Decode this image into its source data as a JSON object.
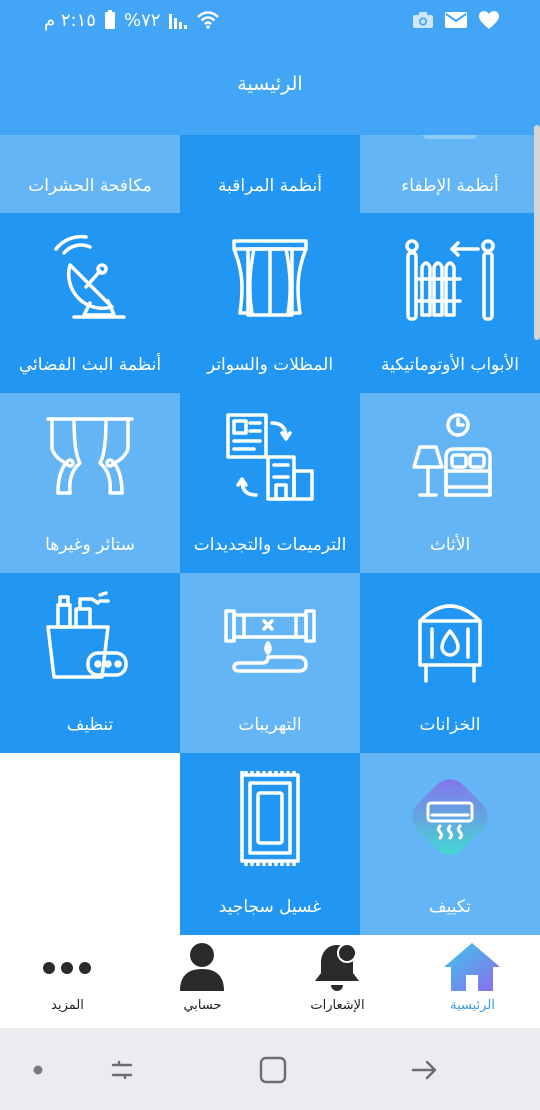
{
  "status_bar": {
    "time": "٢:١٥ م",
    "battery": "٧٢%",
    "icons": [
      "heart-icon",
      "mail-icon",
      "camera-icon",
      "wifi-icon",
      "signal-icon",
      "battery-icon"
    ]
  },
  "app_bar": {
    "title": "الرئيسية"
  },
  "tiles": [
    {
      "label": "أنظمة الإطفاء",
      "icon": "fire-extinguishing-icon",
      "tone": "light"
    },
    {
      "label": "أنظمة المراقبة",
      "icon": "surveillance-icon",
      "tone": "dark"
    },
    {
      "label": "مكافحة الحشرات",
      "icon": "pest-control-icon",
      "tone": "light"
    },
    {
      "label": "الأبواب الأوتوماتيكية",
      "icon": "automatic-gate-icon",
      "tone": "dark"
    },
    {
      "label": "المظلات والسواتر",
      "icon": "window-curtains-icon",
      "tone": "dark"
    },
    {
      "label": "أنظمة البث الفضائي",
      "icon": "satellite-dish-icon",
      "tone": "dark"
    },
    {
      "label": "الأثاث",
      "icon": "furniture-bedroom-icon",
      "tone": "light"
    },
    {
      "label": "الترميمات والتجديدات",
      "icon": "renovation-icon",
      "tone": "dark"
    },
    {
      "label": "ستائر وغيرها",
      "icon": "curtains-icon",
      "tone": "light"
    },
    {
      "label": "الخزانات",
      "icon": "water-tank-icon",
      "tone": "dark"
    },
    {
      "label": "التهريبات",
      "icon": "leaking-pipe-icon",
      "tone": "light"
    },
    {
      "label": "تنظيف",
      "icon": "cleaning-bucket-icon",
      "tone": "dark"
    },
    {
      "label": "تكييف",
      "icon": "air-conditioner-icon",
      "tone": "light"
    },
    {
      "label": "غسيل سجاجيد",
      "icon": "carpet-icon",
      "tone": "dark"
    }
  ],
  "bottom_nav": [
    {
      "label": "الرئيسية",
      "icon": "home-icon",
      "active": true
    },
    {
      "label": "الإشعارات",
      "icon": "bell-icon",
      "active": false
    },
    {
      "label": "حسابي",
      "icon": "user-icon",
      "active": false
    },
    {
      "label": "المزيد",
      "icon": "more-dots-icon",
      "active": false
    }
  ],
  "system_nav": [
    "recent-apps-icon",
    "home-square-icon",
    "back-arrow-icon",
    "dot-indicator-icon"
  ],
  "colors": {
    "primary": "#42A5F5",
    "tile_dark": "#2196F3",
    "tile_light": "#64B5F6",
    "active_nav": "#3C9BE8"
  }
}
